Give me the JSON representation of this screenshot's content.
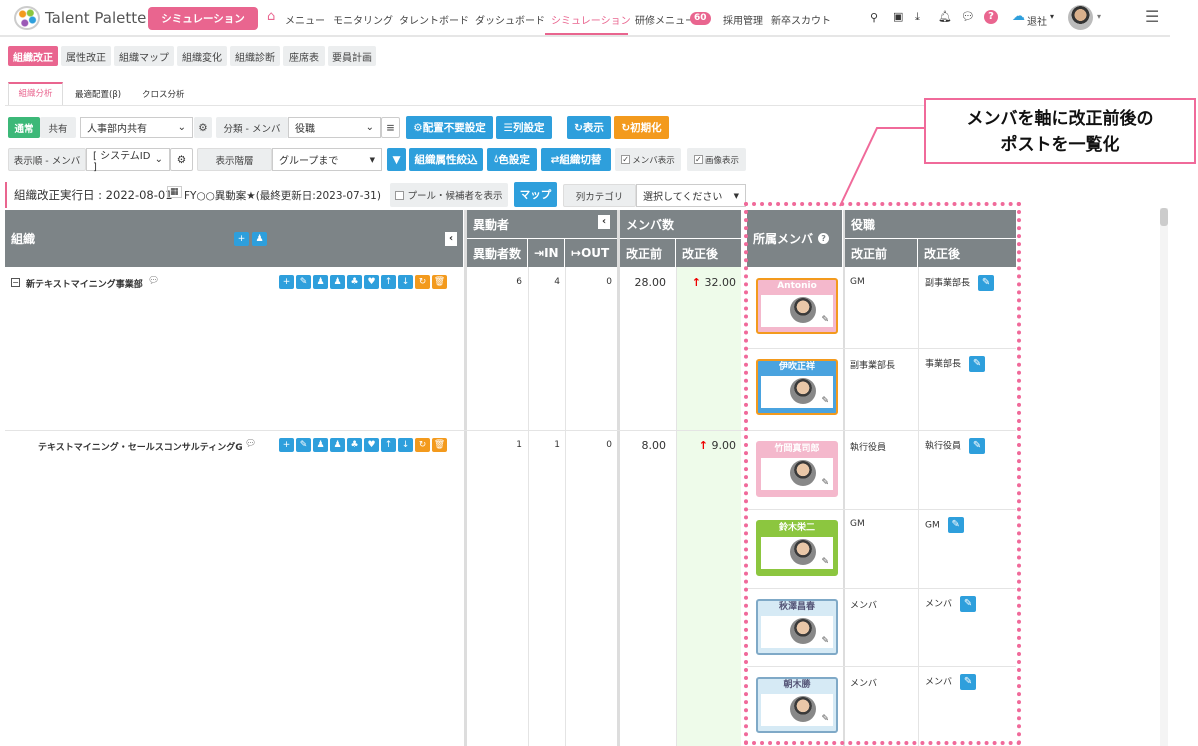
{
  "header": {
    "logo": "Talent Palette",
    "sim_button": "シミュレーション",
    "nav": [
      "メニュー",
      "モニタリング",
      "タレントボード",
      "ダッシュボード",
      "シミュレーション",
      "研修メニュー",
      "採用管理",
      "新卒スカウト"
    ],
    "badge": "60",
    "leave": "退社"
  },
  "subtabs": [
    "組織改正",
    "属性改正",
    "組織マップ",
    "組織変化",
    "組織診断",
    "座席表",
    "要員計画"
  ],
  "tabs": [
    "組織分析",
    "最適配置(β)",
    "クロス分析"
  ],
  "toolbar1": {
    "normal": "通常",
    "shared": "共有",
    "share_select": "人事部内共有",
    "cat_label": "分類 - メンバ",
    "cat_select": "役職",
    "no_place": "配置不要設定",
    "columns": "列設定",
    "show": "表示",
    "reset": "初期化"
  },
  "toolbar2": {
    "order_label": "表示順 - メンバ",
    "order_select": "[ システムID ]",
    "level_label": "表示階層",
    "level_select": "グループまで",
    "attr_filter": "組織属性絞込",
    "color": "色設定",
    "switch": "組織切替",
    "show_members": "メンバ表示",
    "show_images": "画像表示"
  },
  "toolbar3": {
    "date_label": "組織改正実行日 : 2022-08-01",
    "plan": "FY○○異動案★(最終更新日:2023-07-31)",
    "pool": "プール・候補者を表示",
    "map": "マップ",
    "col_cat": "列カテゴリ",
    "col_select": "選択してください"
  },
  "table": {
    "org": "組織",
    "movers": "異動者",
    "movers_count": "異動者数",
    "in": "IN",
    "out": "OUT",
    "members": "メンバ数",
    "before": "改正前",
    "after": "改正後",
    "belong": "所属メンバ",
    "position": "役職",
    "rows": [
      {
        "name": "新テキストマイニング事業部",
        "movers": "6",
        "in": "4",
        "out": "0",
        "before": "28.00",
        "after": "32.00",
        "members": [
          {
            "name": "Antonio",
            "pos_before": "GM",
            "pos_after": "副事業部長",
            "color": "#f4b8cc",
            "border": "#f39a1d",
            "text": "#fff"
          },
          {
            "name": "伊吹正祥",
            "pos_before": "副事業部長",
            "pos_after": "事業部長",
            "color": "#4aa3df",
            "border": "#f39a1d",
            "text": "#fff"
          }
        ]
      },
      {
        "name": "テキストマイニング・セールスコンサルティングG",
        "movers": "1",
        "in": "1",
        "out": "0",
        "before": "8.00",
        "after": "9.00",
        "members": [
          {
            "name": "竹岡真司郎",
            "pos_before": "執行役員",
            "pos_after": "執行役員",
            "color": "#f4b8cc",
            "border": "#f4b8cc",
            "text": "#fff"
          },
          {
            "name": "鈴木栄二",
            "pos_before": "GM",
            "pos_after": "GM",
            "color": "#8cc63f",
            "border": "#8cc63f",
            "text": "#fff"
          },
          {
            "name": "秋澤昌春",
            "pos_before": "メンバ",
            "pos_after": "メンバ",
            "color": "#d6eaf5",
            "border": "#7fa9c7",
            "text": "#557"
          },
          {
            "name": "朝木勝",
            "pos_before": "メンバ",
            "pos_after": "メンバ",
            "color": "#d6eaf5",
            "border": "#7fa9c7",
            "text": "#557"
          }
        ]
      }
    ]
  },
  "callout": {
    "line1": "メンバを軸に改正前後の",
    "line2": "ポストを一覧化"
  },
  "colors": {
    "accent": "#e9658f",
    "blue": "#2e9fdc",
    "orange": "#f39a1d",
    "green": "#3cb878"
  }
}
